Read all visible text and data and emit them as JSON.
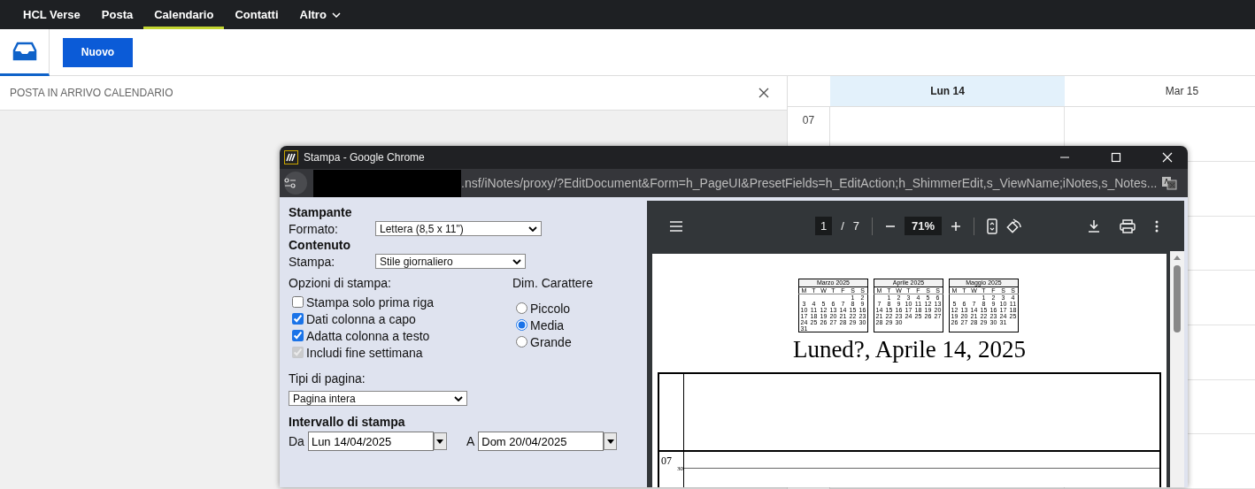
{
  "nav": {
    "tabs": [
      {
        "label": "HCL Verse",
        "selected": false,
        "has_menu": false
      },
      {
        "label": "Posta",
        "selected": false,
        "has_menu": false
      },
      {
        "label": "Calendario",
        "selected": true,
        "has_menu": false
      },
      {
        "label": "Contatti",
        "selected": false,
        "has_menu": false
      },
      {
        "label": "Altro",
        "selected": false,
        "has_menu": true
      }
    ]
  },
  "toolbar": {
    "new_button": "Nuovo"
  },
  "panel": {
    "title": "POSTA IN ARRIVO CALENDARIO"
  },
  "calendar": {
    "days": [
      {
        "label": "Lun 14",
        "selected": true
      },
      {
        "label": "Mar 15",
        "selected": false
      }
    ],
    "hours": [
      "07"
    ]
  },
  "print_window": {
    "title": "Stampa - Google Chrome",
    "url": ".nsf/iNotes/proxy/?EditDocument&Form=h_PageUI&PresetFields=h_EditAction;h_ShimmerEdit,s_ViewName;iNotes,s_Notes...",
    "printer_heading": "Stampante",
    "format": {
      "label": "Formato:",
      "value": "Lettera (8,5 x 11\")"
    },
    "content_heading": "Contenuto",
    "print_style": {
      "label": "Stampa:",
      "value": "Stile giornaliero"
    },
    "options": {
      "label": "Opzioni di stampa:",
      "items": [
        {
          "label": "Stampa solo prima riga",
          "checked": false,
          "disabled": false
        },
        {
          "label": "Dati colonna a capo",
          "checked": true,
          "disabled": false
        },
        {
          "label": "Adatta colonna a testo",
          "checked": true,
          "disabled": false
        },
        {
          "label": "Includi fine settimana",
          "checked": true,
          "disabled": true
        }
      ]
    },
    "font_size": {
      "label": "Dim. Carattere",
      "items": [
        {
          "label": "Piccolo",
          "selected": false
        },
        {
          "label": "Media",
          "selected": true
        },
        {
          "label": "Grande",
          "selected": false
        }
      ]
    },
    "page_type": {
      "label": "Tipi di pagina:",
      "value": "Pagina intera"
    },
    "range": {
      "heading": "Intervallo di stampa",
      "from": {
        "label": "Da",
        "value": "Lun 14/04/2025"
      },
      "to": {
        "label": "A",
        "value": "Dom 20/04/2025"
      }
    },
    "pdf": {
      "page": "1",
      "separator": "/",
      "page_count": "7",
      "zoom": "71%",
      "mini_calendars": [
        {
          "title": "Marzo 2025",
          "weekdays": [
            "M",
            "T",
            "W",
            "T",
            "F",
            "S",
            "S"
          ],
          "weeks": [
            {
              "kind": "first",
              "days": [
                "1",
                "2"
              ]
            },
            {
              "kind": "full",
              "days": [
                "3",
                "4",
                "5",
                "6",
                "7",
                "8",
                "9"
              ]
            },
            {
              "kind": "full",
              "days": [
                "10",
                "11",
                "12",
                "13",
                "14",
                "15",
                "16"
              ]
            },
            {
              "kind": "full",
              "days": [
                "17",
                "18",
                "19",
                "20",
                "21",
                "22",
                "23"
              ]
            },
            {
              "kind": "full",
              "days": [
                "24",
                "25",
                "26",
                "27",
                "28",
                "29",
                "30"
              ]
            },
            {
              "kind": "last",
              "days": [
                "31"
              ]
            }
          ]
        },
        {
          "title": "Aprile 2025",
          "weekdays": [
            "M",
            "T",
            "W",
            "T",
            "F",
            "S",
            "S"
          ],
          "weeks": [
            {
              "kind": "first",
              "days": [
                "1",
                "2",
                "3",
                "4",
                "5",
                "6"
              ]
            },
            {
              "kind": "full",
              "days": [
                "7",
                "8",
                "9",
                "10",
                "11",
                "12",
                "13"
              ]
            },
            {
              "kind": "full",
              "days": [
                "14",
                "15",
                "16",
                "17",
                "18",
                "19",
                "20"
              ]
            },
            {
              "kind": "full",
              "days": [
                "21",
                "22",
                "23",
                "24",
                "25",
                "26",
                "27"
              ]
            },
            {
              "kind": "last",
              "days": [
                "28",
                "29",
                "30"
              ]
            }
          ]
        },
        {
          "title": "Maggio 2025",
          "weekdays": [
            "M",
            "T",
            "W",
            "T",
            "F",
            "S",
            "S"
          ],
          "weeks": [
            {
              "kind": "first",
              "days": [
                "1",
                "2",
                "3",
                "4"
              ]
            },
            {
              "kind": "full",
              "days": [
                "5",
                "6",
                "7",
                "8",
                "9",
                "10",
                "11"
              ]
            },
            {
              "kind": "full",
              "days": [
                "12",
                "13",
                "14",
                "15",
                "16",
                "17",
                "18"
              ]
            },
            {
              "kind": "full",
              "days": [
                "19",
                "20",
                "21",
                "22",
                "23",
                "24",
                "25"
              ]
            },
            {
              "kind": "last",
              "days": [
                "26",
                "27",
                "28",
                "29",
                "30",
                "31"
              ]
            }
          ]
        }
      ],
      "date_title": "Luned?, Aprile 14, 2025",
      "hours": [
        {
          "label": "07",
          "minor": "30"
        }
      ]
    }
  }
}
